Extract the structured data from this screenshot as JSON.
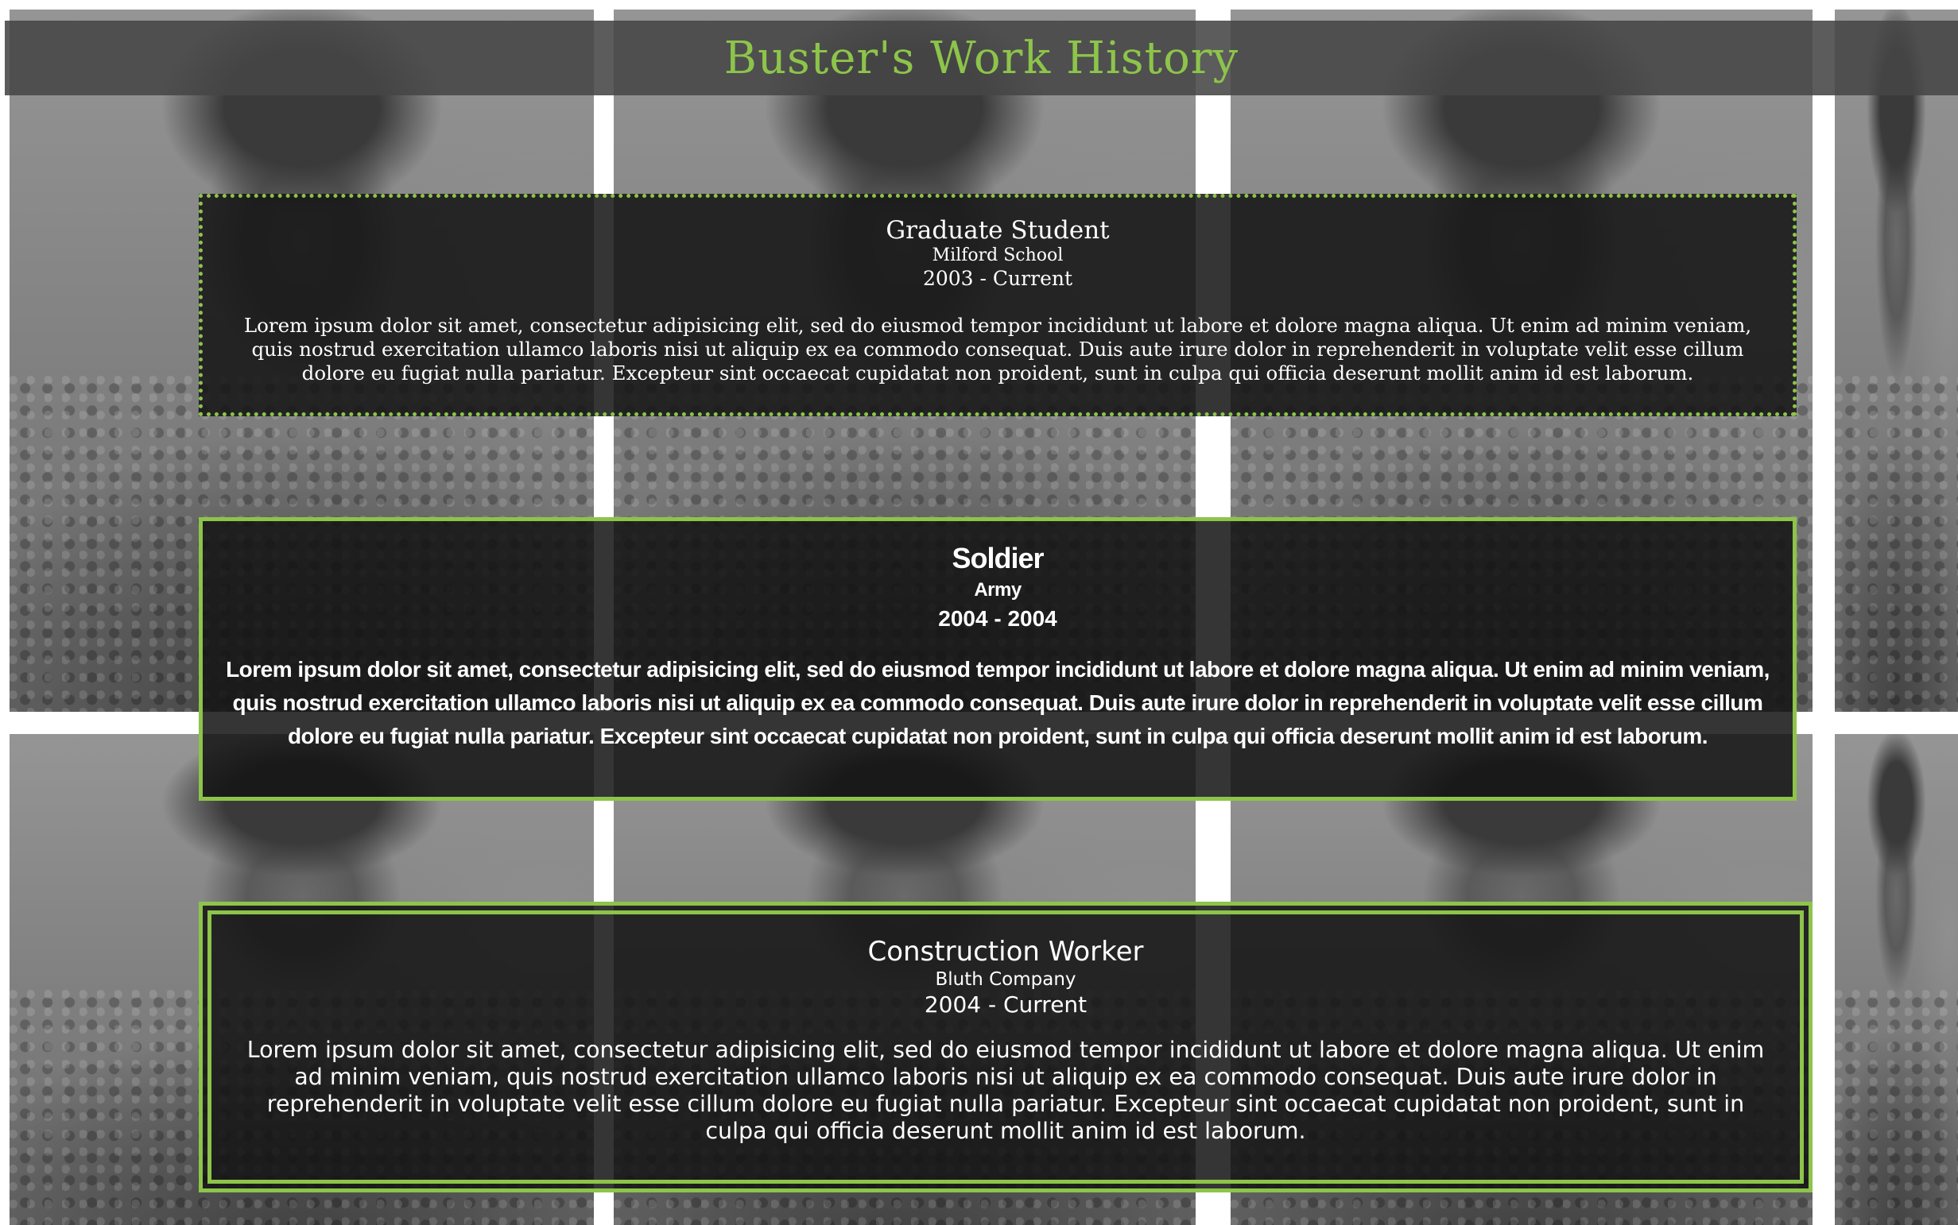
{
  "header": {
    "title": "Buster's Work History"
  },
  "colors": {
    "accent": "#8dc44a",
    "card_background": "#141414",
    "text": "#ffffff"
  },
  "jobs": [
    {
      "title": "Graduate Student",
      "company": "Milford School",
      "dates": "2003 - Current",
      "description": "Lorem ipsum dolor sit amet, consectetur adipisicing elit, sed do eiusmod tempor incididunt ut labore et dolore magna aliqua. Ut enim ad minim veniam, quis nostrud exercitation ullamco laboris nisi ut aliquip ex ea commodo consequat. Duis aute irure dolor in reprehenderit in voluptate velit esse cillum dolore eu fugiat nulla pariatur. Excepteur sint occaecat cupidatat non proident, sunt in culpa qui officia deserunt mollit anim id est laborum."
    },
    {
      "title": "Soldier",
      "company": "Army",
      "dates": "2004 - 2004",
      "description": "Lorem ipsum dolor sit amet, consectetur adipisicing elit, sed do eiusmod tempor incididunt ut labore et dolore magna aliqua. Ut enim ad minim veniam, quis nostrud exercitation ullamco laboris nisi ut aliquip ex ea commodo consequat. Duis aute irure dolor in reprehenderit in voluptate velit esse cillum dolore eu fugiat nulla pariatur. Excepteur sint occaecat cupidatat non proident, sunt in culpa qui officia deserunt mollit anim id est laborum."
    },
    {
      "title": "Construction Worker",
      "company": "Bluth Company",
      "dates": "2004 - Current",
      "description": "Lorem ipsum dolor sit amet, consectetur adipisicing elit, sed do eiusmod tempor incididunt ut labore et dolore magna aliqua. Ut enim ad minim veniam, quis nostrud exercitation ullamco laboris nisi ut aliquip ex ea commodo consequat. Duis aute irure dolor in reprehenderit in voluptate velit esse cillum dolore eu fugiat nulla pariatur. Excepteur sint occaecat cupidatat non proident, sunt in culpa qui officia deserunt mollit anim id est laborum."
    }
  ]
}
